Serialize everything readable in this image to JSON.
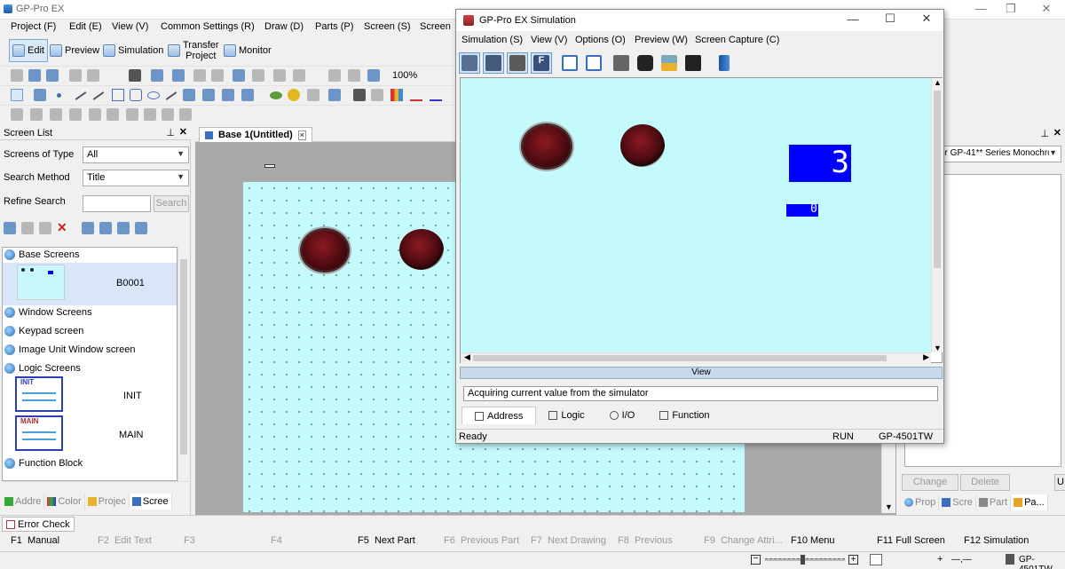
{
  "app": {
    "title": "GP-Pro EX"
  },
  "menu": [
    "Project (F)",
    "Edit (E)",
    "View (V)",
    "Common Settings (R)",
    "Draw (D)",
    "Parts (P)",
    "Screen (S)",
    "Screen"
  ],
  "modes": {
    "edit": "Edit",
    "preview": "Preview",
    "simulation": "Simulation",
    "transfer_line1": "Transfer",
    "transfer_line2": "Project",
    "monitor": "Monitor"
  },
  "zoom": "100%",
  "screen_list": {
    "title": "Screen List",
    "type_label": "Screens of Type",
    "type_value": "All",
    "search_method_label": "Search Method",
    "search_method_value": "Title",
    "refine_label": "Refine Search",
    "search_button": "Search",
    "tree": {
      "base_screens": "Base Screens",
      "base_item": "B0001",
      "window_screens": "Window Screens",
      "keypad_screen": "Keypad screen",
      "image_unit": "Image Unit Window screen",
      "logic_screens": "Logic Screens",
      "init_thumb": "INIT",
      "init_label": "INIT",
      "main_thumb": "MAIN",
      "main_label": "MAIN",
      "function_block": "Function Block"
    },
    "tabs": [
      "Addre",
      "Color",
      "Projec",
      "Scree"
    ]
  },
  "editor": {
    "tab_title": "Base 1(Untitled)",
    "tab_close": "×"
  },
  "right_panel": {
    "combo_value": "or GP-41** Series Monochro",
    "change_button": "Change",
    "delete_button": "Delete",
    "tabs": [
      "Prop",
      "Scre",
      "Part",
      "Pa..."
    ]
  },
  "sim": {
    "title": "GP-Pro EX Simulation",
    "menu": [
      "Simulation (S)",
      "View (V)",
      "Options (O)",
      "Preview (W)",
      "Screen Capture (C)"
    ],
    "numeric1": "3",
    "numeric2": "0",
    "view_bar": "View",
    "status_message": "Acquiring current value from the simulator",
    "tabs": [
      "Address",
      "Logic",
      "I/O",
      "Function"
    ],
    "status_ready": "Ready",
    "status_run": "RUN",
    "status_model": "GP-4501TW"
  },
  "error_check": "Error Check",
  "fkeys": [
    {
      "key": "F1",
      "label": "Manual",
      "enabled": true
    },
    {
      "key": "F2",
      "label": "Edit Text",
      "enabled": false
    },
    {
      "key": "F3",
      "label": "",
      "enabled": false
    },
    {
      "key": "F4",
      "label": "",
      "enabled": false
    },
    {
      "key": "F5",
      "label": "Next Part",
      "enabled": true
    },
    {
      "key": "F6",
      "label": "Previous Part",
      "enabled": false
    },
    {
      "key": "F7",
      "label": "Next Drawing",
      "enabled": false
    },
    {
      "key": "F8",
      "label": "Previous",
      "enabled": false
    },
    {
      "key": "F9",
      "label": "Change Attri...",
      "enabled": false
    },
    {
      "key": "F10",
      "label": "Menu",
      "enabled": true
    },
    {
      "key": "F11",
      "label": "Full Screen",
      "enabled": true
    },
    {
      "key": "F12",
      "label": "Simulation",
      "enabled": true
    }
  ],
  "statusbar": {
    "cursor": "—,—",
    "model": "GP-4501TW"
  },
  "colors": {
    "canvas": "#c4fafc",
    "lamp": "#6a0f18",
    "numeric_display": "#0000ff"
  }
}
